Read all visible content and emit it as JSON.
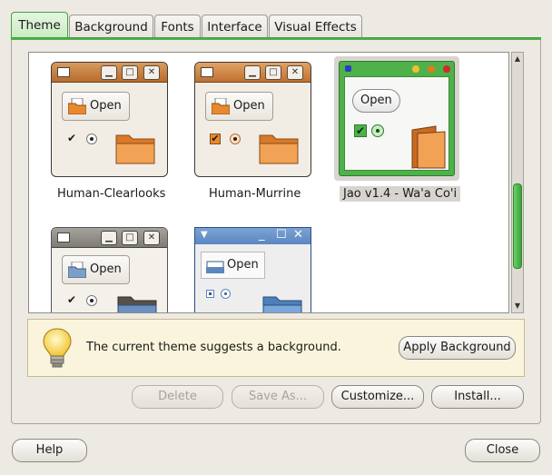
{
  "tabs": [
    {
      "label": "Theme"
    },
    {
      "label": "Background"
    },
    {
      "label": "Fonts"
    },
    {
      "label": "Interface"
    },
    {
      "label": "Visual Effects"
    }
  ],
  "themes": [
    {
      "name": "Human-Clearlooks",
      "open_label": "Open"
    },
    {
      "name": "Human-Murrine",
      "open_label": "Open"
    },
    {
      "name": "Jao v1.4 - Wa'a Co'i",
      "open_label": "Open",
      "selected": true
    },
    {
      "name": "",
      "open_label": "Open"
    },
    {
      "name": "",
      "open_label": "Open"
    }
  ],
  "info": {
    "message": "The current theme suggests a background.",
    "apply_button": "Apply Background"
  },
  "actions": {
    "delete": "Delete",
    "save_as": "Save As...",
    "customize": "Customize...",
    "install": "Install..."
  },
  "footer": {
    "help": "Help",
    "close": "Close"
  },
  "colors": {
    "accent": "#4fb14a",
    "human_orange": "#e8892e",
    "selection": "#d8d5d0"
  }
}
